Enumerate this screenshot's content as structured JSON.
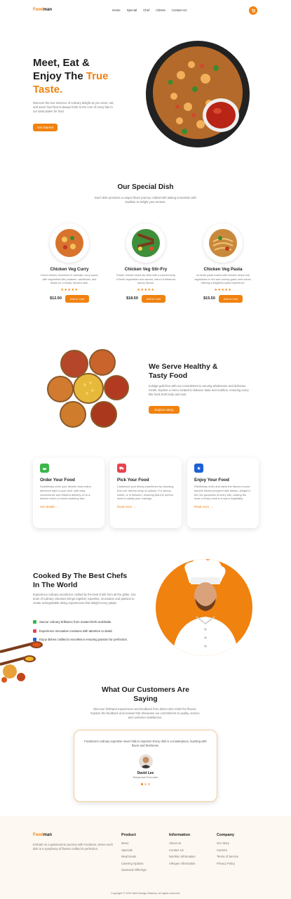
{
  "nav": {
    "logo_a": "Food",
    "logo_b": "man",
    "links": [
      "Home",
      "Special",
      "Chef",
      "Clients",
      "Contact Us"
    ],
    "cart_icon": "cart-icon"
  },
  "hero": {
    "line1": "Meet, Eat &",
    "line2a": "Enjoy The ",
    "line2b": "True",
    "line3": "Taste.",
    "desc": "Discover the true essence of culinary delight as you meet, eat, and savor food that is always fresh to the core of every bite in our ideal plates for food.",
    "cta": "Get Started"
  },
  "special": {
    "title": "Our Special Dish",
    "desc": "Each dish promises a unique flavor journey crafted with lasting innovation with tradition to delight your senses.",
    "dishes": [
      {
        "name": "Chicken Veg Curry",
        "desc": "Diced chicken simmered in aromatic curry sauce with vegetables like potatoes, cauliflower, and beans for a hearty, flavorful dish.",
        "price": "$12.50",
        "button": "Add to Cart"
      },
      {
        "name": "Chicken Veg Stir-Fry",
        "desc": "Tender chicken strips stir-fried with a colorful array of fresh vegetables and sauces, blend of balanced savory flavors.",
        "price": "$18.50",
        "button": "Add to Cart"
      },
      {
        "name": "Chicken Veg Pasta",
        "desc": "Al dente pasta tossed with chicken strips and vegetables in rich and creamy garlic herb sauce, offering a delightful pasta experience.",
        "price": "$15.50",
        "button": "Add to Cart"
      }
    ],
    "stars": "★★★★★"
  },
  "healthy": {
    "title1": "We Serve Healthy &",
    "title2": "Tasty Food",
    "desc": "Indulge guilt-free with our commitment to serving wholesome and delicious meals. Explore a menu curated to balance taste and nutrition, ensuring every bite fuels both body and soul.",
    "cta": "Explore Story"
  },
  "steps": [
    {
      "title": "Order Your Food",
      "desc": "Seamlessly order your favorite food online, delivered right to your door, with easy convenience and efficient delivery on to a diverse menu of mouth-watering fare.",
      "link": "See details",
      "color": "#3cb54a",
      "icon": "bowl-icon"
    },
    {
      "title": "Pick Your Food",
      "desc": "Customize your dining experience by choosing from our diverse array of options. For savory, sweet, or in between, ensuring that the perfect meal to satisfy your cravings.",
      "link": "Read more",
      "color": "#e8434f",
      "icon": "truck-icon"
    },
    {
      "title": "Enjoy Your Food",
      "desc": "Effortlessly order and savor the flavors of your favorite dishes prepared with artisan, delight in the rich goodness of every bite, making the most of every meal in a warm hospitality.",
      "link": "Read more",
      "color": "#1d5fd6",
      "icon": "star-icon"
    }
  ],
  "chefs": {
    "title1": "Cooked By The Best Chefs",
    "title2": "In The World",
    "desc": "Experience culinary excellence crafted by the best chefs from all the globe. Our team of culinary virtuosos brings together expertise, innovation and passion to create unforgettable dining experiences that delight every palate.",
    "points": [
      {
        "text": "Savour culinary brilliance from masterchefs worldwide.",
        "color": "#3cb54a"
      },
      {
        "text": "Experience innovative creations with attention to detail.",
        "color": "#e8434f"
      },
      {
        "text": "Enjoy dishes crafted to excellence ensuring passion for perfection.",
        "color": "#1d5fd6"
      }
    ]
  },
  "testimonials": {
    "title1": "What Our Customers Are",
    "title2": "Saying",
    "desc": "Discover firsthand experiences and feedback from diners who relish the flavors. Explore the feedback and reviews that showcase our commitment to quality, service and customer satisfaction.",
    "quote": "Foodman's culinary expertise never fails to impress! Every dish is a masterpiece, bursting with flavor and freshness.",
    "name": "David Lee",
    "role": "Restaurant Executive"
  },
  "footer": {
    "logo_a": "Food",
    "logo_b": "man",
    "about": "Embark on a gastronomic journey with Foodman, where each dish is a symphony of flavors crafted to perfection.",
    "columns": [
      {
        "title": "Product",
        "items": [
          "Menu",
          "Specials",
          "Meal Deals",
          "Catering Options",
          "Seasonal Offerings"
        ]
      },
      {
        "title": "Information",
        "items": [
          "About Us",
          "Contact Us",
          "Nutrition Information",
          "Allergen Information"
        ]
      },
      {
        "title": "Company",
        "items": [
          "Our Story",
          "Careers",
          "Terms of Service",
          "Privacy Policy"
        ]
      }
    ],
    "copyright": "Copyright © 2024 Web Design Mastery. All rights reserved."
  }
}
